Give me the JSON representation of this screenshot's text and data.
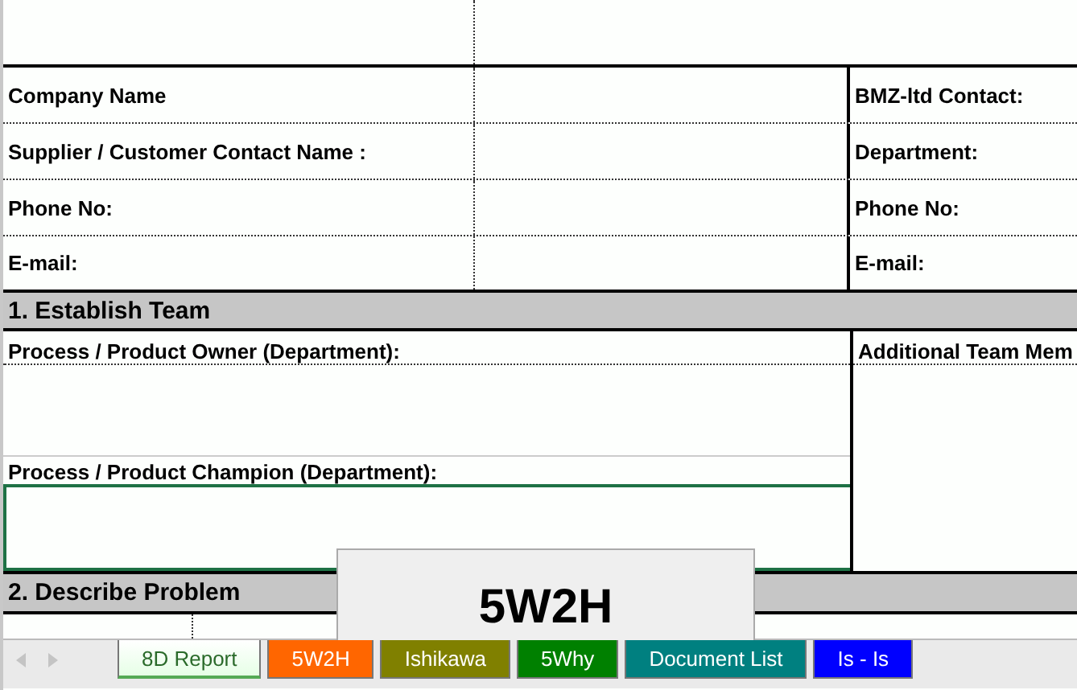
{
  "contact_table": {
    "rows": [
      {
        "left_label": "Company Name",
        "right_label": "BMZ-ltd Contact:"
      },
      {
        "left_label": "Supplier / Customer Contact Name :",
        "right_label": "Department:"
      },
      {
        "left_label": "Phone No:",
        "right_label": "Phone No:"
      },
      {
        "left_label": "E-mail:",
        "right_label": "E-mail:"
      }
    ]
  },
  "establish_team": {
    "title": "1. Establish Team",
    "owner_label": "Process / Product Owner (Department):",
    "champion_label": "Process / Product Champion (Department):",
    "champion_cell": {
      "selected": true
    },
    "additional_label": "Additional Team Mem"
  },
  "describe_problem": {
    "title": "2. Describe Problem"
  },
  "shape": {
    "text": "5W2H"
  },
  "sheet_tabs": [
    {
      "label": "8D Report",
      "color": "#e6ffe6",
      "selected": true
    },
    {
      "label": "5W2H",
      "color": "#ff6600",
      "selected": false
    },
    {
      "label": "Ishikawa",
      "color": "#808000",
      "selected": false
    },
    {
      "label": "5Why",
      "color": "#008000",
      "selected": false
    },
    {
      "label": "Document List",
      "color": "#008080",
      "selected": false
    },
    {
      "label": "Is - Is",
      "color": "#0000ff",
      "selected": false
    }
  ]
}
